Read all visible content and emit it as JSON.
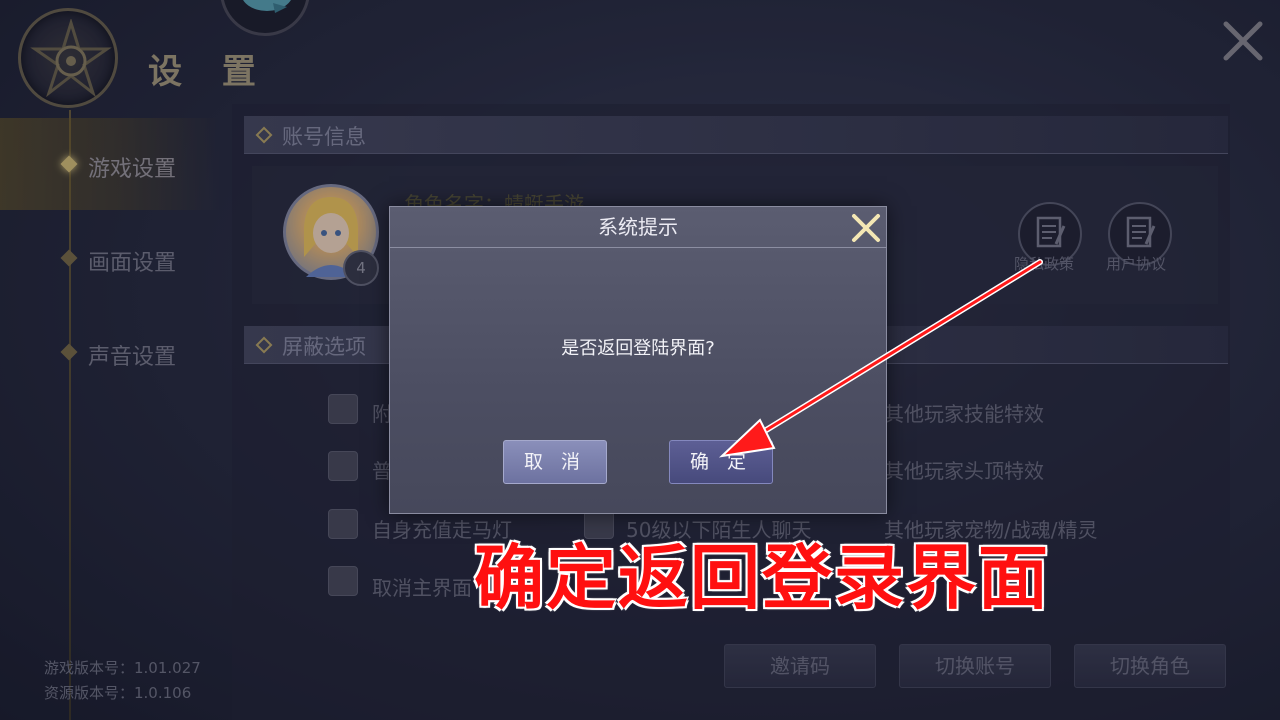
{
  "header": {
    "title": "设 置"
  },
  "sidebar": {
    "items": [
      {
        "label": "游戏设置",
        "active": true
      },
      {
        "label": "画面设置",
        "active": false
      },
      {
        "label": "声音设置",
        "active": false
      }
    ]
  },
  "version": {
    "game": "游戏版本号：1.01.027",
    "resource": "资源版本号：1.0.106"
  },
  "account": {
    "section_title": "账号信息",
    "role_name": "角色名字：蜻蜓手游",
    "level": "4",
    "privacy_label": "隐私政策",
    "agreement_label": "用户协议"
  },
  "filter": {
    "section_title": "屏蔽选项",
    "options": [
      {
        "label": "附"
      },
      {
        "label": "其他玩家技能特效"
      },
      {
        "label": "普"
      },
      {
        "label": "其他玩家头顶特效"
      },
      {
        "label": "自身充值走马灯"
      },
      {
        "label": "50级以下陌生人聊天"
      },
      {
        "label": "其他玩家宠物/战魂/精灵"
      },
      {
        "label": "取消主界面"
      }
    ]
  },
  "bottom_buttons": {
    "invite": "邀请码",
    "switch_account": "切换账号",
    "switch_role": "切换角色"
  },
  "dialog": {
    "title": "系统提示",
    "message": "是否返回登陆界面?",
    "cancel": "取 消",
    "confirm": "确 定"
  },
  "annotation": {
    "text": "确定返回登录界面",
    "color": "#ff1010"
  },
  "colors": {
    "accent_gold": "#d9c27a",
    "background": "#2a2e44"
  }
}
